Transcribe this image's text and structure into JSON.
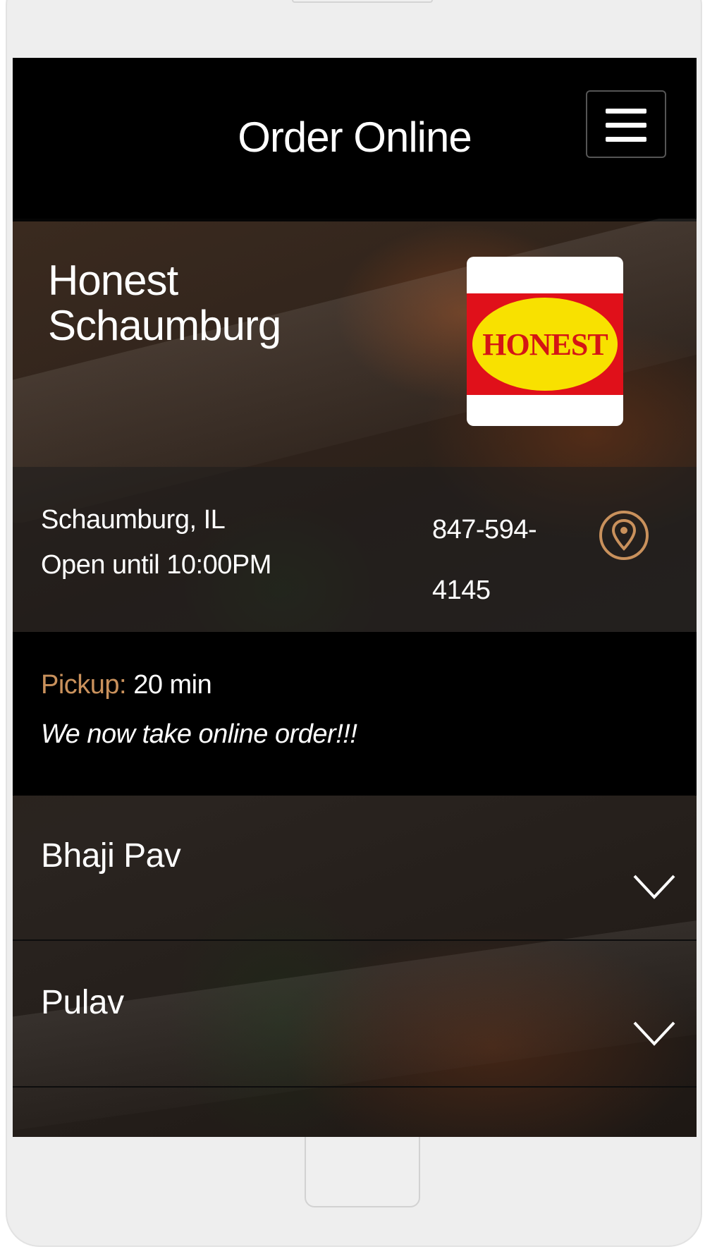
{
  "header": {
    "title": "Order Online",
    "menu_icon": "hamburger-menu-icon"
  },
  "restaurant": {
    "name_line1": "Honest",
    "name_line2": "Schaumburg",
    "logo_text": "HONEST",
    "logo_colors": {
      "red": "#e0101a",
      "yellow": "#f8e100",
      "white": "#ffffff"
    }
  },
  "info": {
    "location": "Schaumburg, IL",
    "hours": "Open until 10:00PM",
    "phone_line1": "847-594-",
    "phone_line2": "4145",
    "location_icon": "map-pin-icon"
  },
  "pickup": {
    "label": "Pickup:",
    "value": "20 min",
    "announcement": "We now take online order!!!"
  },
  "menu": {
    "categories": [
      {
        "name": "Bhaji Pav",
        "icon": "chevron-down-icon"
      },
      {
        "name": "Pulav",
        "icon": "chevron-down-icon"
      }
    ]
  },
  "colors": {
    "accent": "#c9915c",
    "header_bg": "#000000",
    "text": "#ffffff"
  }
}
